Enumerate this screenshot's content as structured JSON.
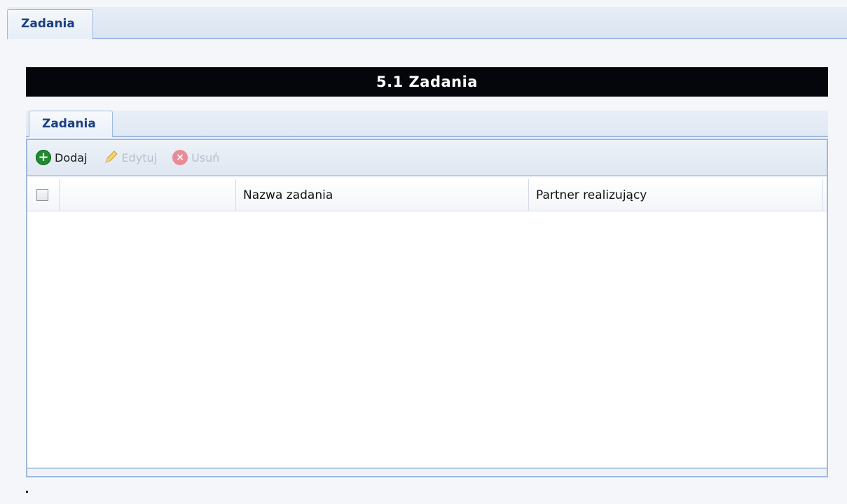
{
  "top_tab": {
    "label": "Zadania"
  },
  "section": {
    "title": "5.1 Zadania"
  },
  "inner_tab": {
    "label": "Zadania"
  },
  "toolbar": {
    "add_label": "Dodaj",
    "edit_label": "Edytuj",
    "delete_label": "Usuń",
    "add_icon": "plus-circle-icon",
    "edit_icon": "pencil-icon",
    "delete_icon": "x-circle-icon"
  },
  "grid": {
    "columns": [
      "",
      "",
      "Nazwa zadania",
      "Partner realizujący"
    ],
    "rows": []
  },
  "colors": {
    "header_bar": "#05060b",
    "tab_text": "#1b3f82",
    "border": "#9fb8dd",
    "add_icon": "#1f8a2e",
    "disabled_text": "#b9bfca"
  }
}
